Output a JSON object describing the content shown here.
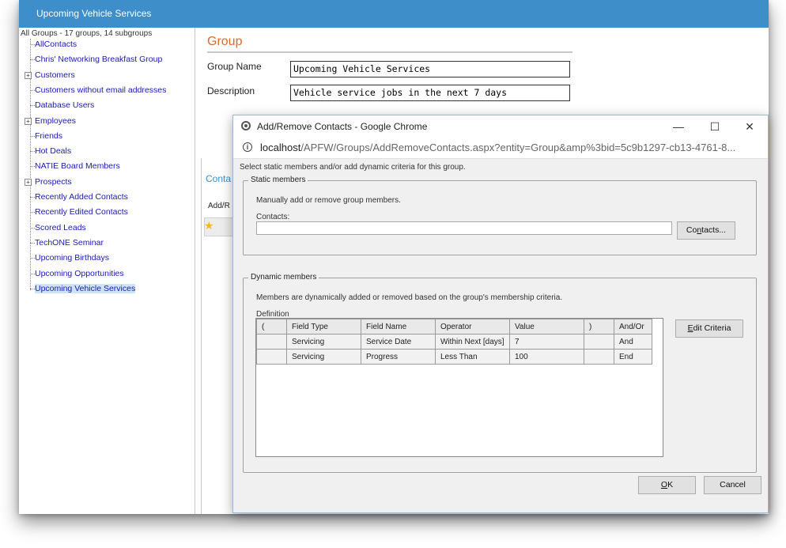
{
  "app": {
    "header_title": "Upcoming Vehicle Services"
  },
  "sidebar": {
    "root_label": "All Groups - 17 groups, 14 subgroups",
    "items": [
      {
        "label": "AllContacts",
        "expandable": false
      },
      {
        "label": "Chris' Networking Breakfast Group",
        "expandable": false
      },
      {
        "label": "Customers",
        "expandable": true
      },
      {
        "label": "Customers without email addresses",
        "expandable": false
      },
      {
        "label": "Database Users",
        "expandable": false
      },
      {
        "label": "Employees",
        "expandable": true
      },
      {
        "label": "Friends",
        "expandable": false
      },
      {
        "label": "Hot Deals",
        "expandable": false
      },
      {
        "label": "NATIE Board Members",
        "expandable": false
      },
      {
        "label": "Prospects",
        "expandable": true
      },
      {
        "label": "Recently Added Contacts",
        "expandable": false
      },
      {
        "label": "Recently Edited Contacts",
        "expandable": false
      },
      {
        "label": "Scored Leads",
        "expandable": false
      },
      {
        "label": "TechONE Seminar",
        "expandable": false
      },
      {
        "label": "Upcoming Birthdays",
        "expandable": false
      },
      {
        "label": "Upcoming Opportunities",
        "expandable": false
      },
      {
        "label": "Upcoming Vehicle Services",
        "expandable": false,
        "selected": true
      }
    ]
  },
  "main": {
    "section_title": "Group",
    "group_name_label": "Group Name",
    "group_name_value": "Upcoming Vehicle Services",
    "description_label": "Description",
    "description_value": "Vehicle service jobs in the next 7 days",
    "tab_partial": "Conta",
    "addr_partial": "Add/R"
  },
  "popup": {
    "window_title": "Add/Remove Contacts - Google Chrome",
    "minimize": "—",
    "maximize": "☐",
    "close": "✕",
    "url_host": "localhost",
    "url_path": "/APFW/Groups/AddRemoveContacts.aspx?entity=Group&amp%3bid=5c9b1297-cb13-4761-8...",
    "instruction": "Select static members and/or add dynamic criteria for this group.",
    "static": {
      "legend": "Static members",
      "description": "Manually add or remove group members.",
      "contacts_label": "Contacts:",
      "contacts_value": "",
      "contacts_button_pre": "Co",
      "contacts_button_u": "n",
      "contacts_button_post": "tacts..."
    },
    "dynamic": {
      "legend": "Dynamic members",
      "description": "Members are dynamically added or removed based on the group's membership criteria.",
      "definition_label": "Definition",
      "edit_button_u": "E",
      "edit_button_post": "dit Criteria",
      "columns": [
        "(",
        "Field Type",
        "Field Name",
        "Operator",
        "Value",
        ")",
        "And/Or"
      ],
      "rows": [
        [
          "",
          "Servicing",
          "Service Date",
          "Within Next [days]",
          "7",
          "",
          "And"
        ],
        [
          "",
          "Servicing",
          "Progress",
          "Less Than",
          "100",
          "",
          "End"
        ]
      ]
    },
    "ok_u": "O",
    "ok_post": "K",
    "cancel": "Cancel"
  }
}
